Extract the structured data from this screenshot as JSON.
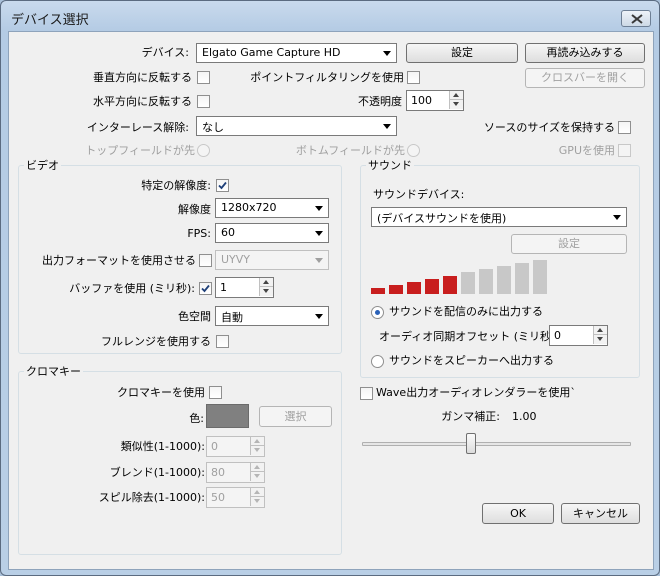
{
  "window": {
    "title": "デバイス選択"
  },
  "device": {
    "label": "デバイス:",
    "value": "Elgato Game Capture HD",
    "settings_button": "設定",
    "reload_button": "再読み込みする",
    "crossbar_button": "クロスバーを開く"
  },
  "flip_vertical": {
    "label": "垂直方向に反転する",
    "checked": false
  },
  "flip_horizontal": {
    "label": "水平方向に反転する",
    "checked": false
  },
  "point_filter": {
    "label": "ポイントフィルタリングを使用",
    "checked": false
  },
  "opacity": {
    "label": "不透明度",
    "value": "100"
  },
  "deinterlace": {
    "label": "インターレース解除:",
    "value": "なし"
  },
  "keep_source_size": {
    "label": "ソースのサイズを保持する",
    "checked": false
  },
  "top_field_first": {
    "label": "トップフィールドが先"
  },
  "bottom_field_first": {
    "label": "ボトムフィールドが先"
  },
  "use_gpu": {
    "label": "GPUを使用"
  },
  "video": {
    "title": "ビデオ",
    "custom_resolution": {
      "label": "特定の解像度:",
      "checked": true
    },
    "resolution": {
      "label": "解像度",
      "value": "1280x720"
    },
    "fps": {
      "label": "FPS:",
      "value": "60"
    },
    "output_format": {
      "label": "出力フォーマットを使用させる",
      "value": "UYVY"
    },
    "buffer": {
      "label": "バッファを使用 (ミリ秒):",
      "checked": true,
      "value": "1"
    },
    "color_space": {
      "label": "色空間",
      "value": "自動"
    },
    "full_range": {
      "label": "フルレンジを使用する"
    }
  },
  "chroma": {
    "title": "クロマキー",
    "use": {
      "label": "クロマキーを使用"
    },
    "color": {
      "label": "色:",
      "swatch": "#808080",
      "select_button": "選択"
    },
    "similarity": {
      "label": "類似性(1-1000):",
      "value": "0"
    },
    "blend": {
      "label": "ブレンド(1-1000):",
      "value": "80"
    },
    "spill": {
      "label": "スピル除去(1-1000):",
      "value": "50"
    }
  },
  "sound": {
    "title": "サウンド",
    "device_label": "サウンドデバイス:",
    "device_value": "(デバイスサウンドを使用)",
    "settings_button": "設定",
    "meter": {
      "active_bars": 5,
      "total_bars": 10,
      "active_color": "#c81e1e",
      "inactive_color": "#c8c8c8"
    },
    "stream_only": {
      "label": "サウンドを配信のみに出力する",
      "selected": true
    },
    "sync_offset": {
      "label": "オーディオ同期オフセット (ミリ秒):",
      "value": "0"
    },
    "to_speakers": {
      "label": "サウンドをスピーカーへ出力する",
      "selected": false
    }
  },
  "wave_renderer": {
    "label": "Wave出力オーディオレンダラーを使用`"
  },
  "gamma": {
    "label": "ガンマ補正:",
    "value": "1.00",
    "slider_fraction": 0.4
  },
  "ok_button": "OK",
  "cancel_button": "キャンセル"
}
